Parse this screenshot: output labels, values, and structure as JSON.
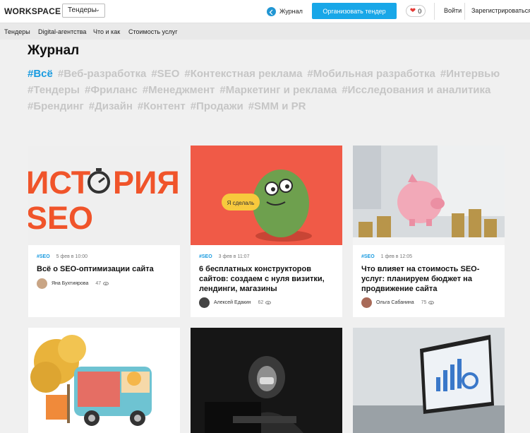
{
  "header": {
    "logo": "WORKSPACE",
    "tender_select": "Тендеры",
    "journal": "Журнал",
    "cta": "Организовать тендер",
    "favorites_count": "0",
    "login": "Войти",
    "register": "Зарегистрироваться"
  },
  "subnav": [
    "Тендеры",
    "Digital-агентства",
    "Что и как",
    "Стоимость услуг"
  ],
  "page_title": "Журнал",
  "tags": [
    "#Всё",
    "#Веб-разработка",
    "#SEO",
    "#Контекстная реклама",
    "#Мобильная разработка",
    "#Интервью",
    "#Тендеры",
    "#Фриланс",
    "#Менеджмент",
    "#Маркетинг и реклама",
    "#Исследования и аналитика",
    "#Брендинг",
    "#Дизайн",
    "#Контент",
    "#Продажи",
    "#SMM и PR"
  ],
  "cards": [
    {
      "tag": "#SEO",
      "date": "5 фев в 10:00",
      "title": "Всё о SEO-оптимизации сайта",
      "author": "Яна Бухтиярова",
      "views": "47",
      "image_text_1": "ИСТ",
      "image_text_2": "РИЯ",
      "image_text_3": "SEO"
    },
    {
      "tag": "#SEO",
      "date": "3 фев в 11:07",
      "title": "6 бесплатных конструкторов сайтов: создаем с нуля визитки, лендинги, магазины",
      "author": "Алексей Едакин",
      "views": "62",
      "image_bubble": "Я сделаль"
    },
    {
      "tag": "#SEO",
      "date": "1 фев в 12:05",
      "title": "Что влияет на стоимость SEO-услуг: планируем бюджет на продвижение сайта",
      "author": "Ольга Сабанина",
      "views": "75"
    }
  ],
  "colors": {
    "accent": "#1a9be0",
    "cta": "#18a7e8",
    "seo_orange": "#f0542a",
    "card2_bg": "#f05a47"
  }
}
